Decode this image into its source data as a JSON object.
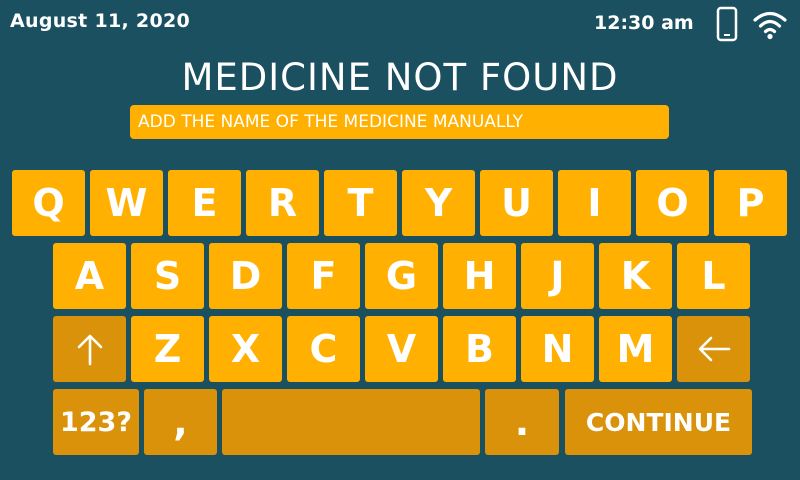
{
  "status": {
    "date": "August 11, 2020",
    "time": "12:30 am",
    "icons": [
      "phone-icon",
      "wifi-icon"
    ]
  },
  "title": "MEDICINE NOT FOUND",
  "input": {
    "placeholder": "ADD THE NAME OF THE MEDICINE MANUALLY",
    "value": ""
  },
  "keyboard": {
    "row1": [
      "Q",
      "W",
      "E",
      "R",
      "T",
      "Y",
      "U",
      "I",
      "O",
      "P"
    ],
    "row2": [
      "A",
      "S",
      "D",
      "F",
      "G",
      "H",
      "J",
      "K",
      "L"
    ],
    "row3": [
      "Z",
      "X",
      "C",
      "V",
      "B",
      "N",
      "M"
    ],
    "shift_icon": "arrow-up-icon",
    "backspace_icon": "arrow-left-icon",
    "numbers_label": "123?",
    "comma_label": ",",
    "period_label": ".",
    "continue_label": "CONTINUE"
  },
  "colors": {
    "background": "#1b5061",
    "key": "#ffb000",
    "key_dark": "#d9920a",
    "text": "#ffffff"
  }
}
